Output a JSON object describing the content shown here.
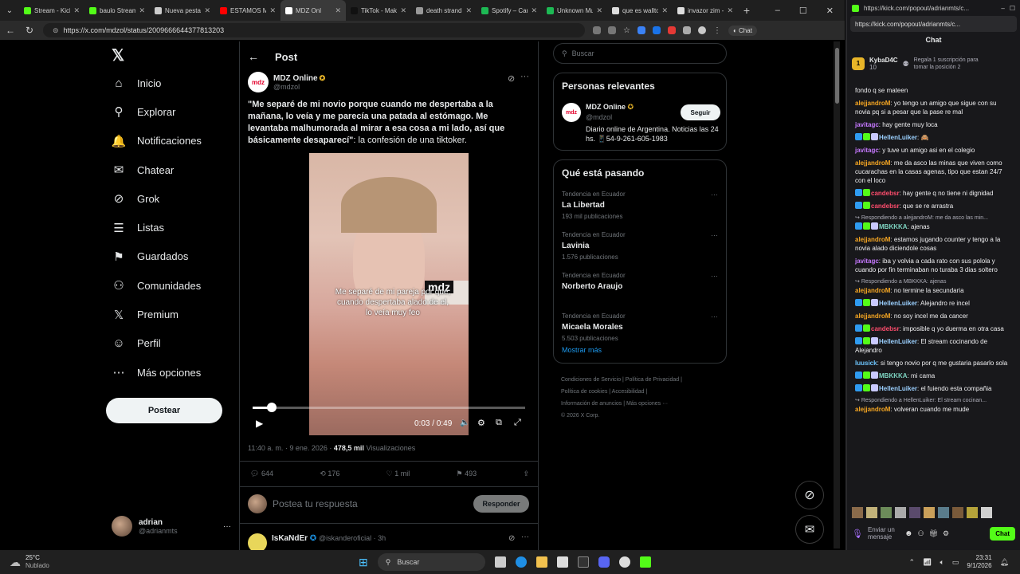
{
  "browser": {
    "tabs": [
      {
        "label": "Stream - Kick",
        "color": "#53fc18"
      },
      {
        "label": "baulo Stream",
        "color": "#53fc18"
      },
      {
        "label": "Nueva pestañ",
        "color": "#cccccc"
      },
      {
        "label": "ESTAMOS MU",
        "color": "#ff0000"
      },
      {
        "label": "MDZ Onl",
        "color": "#ffffff",
        "active": true
      },
      {
        "label": "TikTok - Make",
        "color": "#111111"
      },
      {
        "label": "death strand",
        "color": "#999999"
      },
      {
        "label": "Spotify – Can",
        "color": "#1db954"
      },
      {
        "label": "Unknown Mu",
        "color": "#1db954"
      },
      {
        "label": "que es wallto",
        "color": "#dddddd"
      },
      {
        "label": "invazor zim -",
        "color": "#dddddd"
      }
    ],
    "url": "https://x.com/mdzol/status/2009666644377813203"
  },
  "x_nav": {
    "items": [
      {
        "label": "Inicio",
        "icon": "home-icon",
        "glyph": "⌂"
      },
      {
        "label": "Explorar",
        "icon": "search-icon",
        "glyph": "⚲"
      },
      {
        "label": "Notificaciones",
        "icon": "bell-icon",
        "glyph": "🔔"
      },
      {
        "label": "Chatear",
        "icon": "mail-icon",
        "glyph": "✉"
      },
      {
        "label": "Grok",
        "icon": "grok-icon",
        "glyph": "⊘"
      },
      {
        "label": "Listas",
        "icon": "list-icon",
        "glyph": "☰"
      },
      {
        "label": "Guardados",
        "icon": "bookmark-icon",
        "glyph": "⚑"
      },
      {
        "label": "Comunidades",
        "icon": "people-icon",
        "glyph": "⚇"
      },
      {
        "label": "Premium",
        "icon": "x-icon",
        "glyph": "𝕏"
      },
      {
        "label": "Perfil",
        "icon": "person-icon",
        "glyph": "☺"
      },
      {
        "label": "Más opciones",
        "icon": "more-icon",
        "glyph": "⋯"
      }
    ],
    "post_button": "Postear",
    "user_name": "adrian",
    "user_handle": "@adrianmts"
  },
  "post": {
    "header": "Post",
    "author": "MDZ Online",
    "handle": "@mdzol",
    "text_bold": "\"Me separé de mi novio porque cuando me despertaba a la mañana, lo veía y me parecía una patada al estómago. Me levantaba malhumorada al mirar a esa cosa a mi lado, así que básicamente desaparecí\"",
    "text_rest": ": la confesión de una tiktoker.",
    "video_caption": "Me separé de mi pareja por que, cuando despertaba alado de el, lo veía muy feo",
    "video_logo": "mdz",
    "video_time": "0:03 / 0:49",
    "video_progress": 0.07,
    "timestamp": "11:40 a. m. · 9 ene. 2026 · ",
    "views": "478,5 mil",
    "views_label": " Visualizaciones",
    "replies": "644",
    "reposts": "176",
    "likes": "1 mil",
    "bookmarks": "493",
    "reply_placeholder": "Postea tu respuesta",
    "reply_button": "Responder",
    "next_author": "IsKaNdEr",
    "next_handle": "@iskanderoficial · 3h"
  },
  "sidebar": {
    "search_placeholder": "Buscar",
    "relevant_title": "Personas relevantes",
    "relevant_name": "MDZ Online",
    "relevant_handle": "@mdzol",
    "follow": "Seguir",
    "relevant_bio": "Diario online de Argentina. Noticias las 24 hs. 📱54-9-261-605-1983",
    "trends_title": "Qué está pasando",
    "trends": [
      {
        "category": "Tendencia en Ecuador",
        "name": "La Libertad",
        "count": "193 mil publicaciones"
      },
      {
        "category": "Tendencia en Ecuador",
        "name": "Lavinia",
        "count": "1.576 publicaciones"
      },
      {
        "category": "Tendencia en Ecuador",
        "name": "Norberto Araujo",
        "count": ""
      },
      {
        "category": "Tendencia en Ecuador",
        "name": "Micaela Morales",
        "count": "5.503 publicaciones"
      }
    ],
    "show_more": "Mostrar más",
    "footer1": "Condiciones de Servicio  |  Política de Privacidad  |",
    "footer2": "Política de cookies  |  Accesibilidad  |",
    "footer3": "Información de anuncios  |  Más opciones ···",
    "footer4": "© 2026 X Corp."
  },
  "kick": {
    "url": "https://kick.com/popout/adrianmts/c...",
    "title": "Chat",
    "pinned_user": "KybaD4C",
    "pinned_count": "10",
    "pinned_text": "Regala 1 suscripción para tomar la posición 2",
    "messages": [
      {
        "reply": "",
        "user": "",
        "color": "#efeff1",
        "text": "fondo q se mateen",
        "badges": 0
      },
      {
        "reply": "",
        "user": "alejjandroM",
        "color": "#f5a623",
        "text": "yo tengo un amigo que sigue con su novia pq si a pesar que la pase re mal",
        "badges": 0
      },
      {
        "reply": "",
        "user": "javitagc",
        "color": "#c679ff",
        "text": "hay gente muy loca",
        "badges": 0
      },
      {
        "reply": "",
        "user": "HellenLuiker",
        "color": "#9bd0ff",
        "text": "🙈",
        "badges": 3
      },
      {
        "reply": "",
        "user": "javitagc",
        "color": "#c679ff",
        "text": "y tuve un amigo asi en el colegio",
        "badges": 0
      },
      {
        "reply": "",
        "user": "alejjandroM",
        "color": "#f5a623",
        "text": "me da asco las minas que viven como cucarachas en la casas agenas, tipo que estan 24/7 con el loco",
        "badges": 0
      },
      {
        "reply": "",
        "user": "candebsr",
        "color": "#ff4d6d",
        "text": "hay gente q no tiene ni dignidad",
        "badges": 2
      },
      {
        "reply": "",
        "user": "candebsr",
        "color": "#ff4d6d",
        "text": "que se re arrastra",
        "badges": 2
      },
      {
        "reply": "Respondiendo a alejjandroM: me da asco las min...",
        "user": "MBKKKA",
        "color": "#7dd3c0",
        "text": "ajenas",
        "badges": 3
      },
      {
        "reply": "",
        "user": "alejjandroM",
        "color": "#f5a623",
        "text": "estamos jugando counter y tengo a la novia alado diciendole cosas",
        "badges": 0
      },
      {
        "reply": "",
        "user": "javitagc",
        "color": "#c679ff",
        "text": "iba y volvia a cada rato con sus polola y cuando por fin terminaban no turaba 3 dias soltero",
        "badges": 0
      },
      {
        "reply": "Respondiendo a MBKKKA: ajenas",
        "user": "alejjandroM",
        "color": "#f5a623",
        "text": "no termine la secundaria",
        "badges": 0
      },
      {
        "reply": "",
        "user": "HellenLuiker",
        "color": "#9bd0ff",
        "text": "Alejandro re incel",
        "badges": 3
      },
      {
        "reply": "",
        "user": "alejjandroM",
        "color": "#f5a623",
        "text": "no soy incel me da cancer",
        "badges": 0
      },
      {
        "reply": "",
        "user": "candebsr",
        "color": "#ff4d6d",
        "text": "imposible q yo duerma en otra casa",
        "badges": 2
      },
      {
        "reply": "",
        "user": "HellenLuiker",
        "color": "#9bd0ff",
        "text": "El stream cocinando de Alejandro",
        "badges": 3
      },
      {
        "reply": "",
        "user": "luusick",
        "color": "#6ec6ff",
        "text": "si tengo novio por q me gustaria pasarlo sola",
        "badges": 0
      },
      {
        "reply": "",
        "user": "MBKKKA",
        "color": "#7dd3c0",
        "text": "mi cama",
        "badges": 3
      },
      {
        "reply": "",
        "user": "HellenLuiker",
        "color": "#9bd0ff",
        "text": "el fuiendo esta compañia",
        "badges": 3
      },
      {
        "reply": "Respondiendo a HellenLuiker: El stream cocinan...",
        "user": "alejjandroM",
        "color": "#f5a623",
        "text": "volveran cuando me mude",
        "badges": 0
      }
    ],
    "input_placeholder": "Enviar un mensaje",
    "chat_button": "Chat"
  },
  "taskbar": {
    "weather_temp": "25°C",
    "weather_desc": "Nublado",
    "search": "Buscar",
    "time": "23:31",
    "date": "9/1/2026"
  }
}
